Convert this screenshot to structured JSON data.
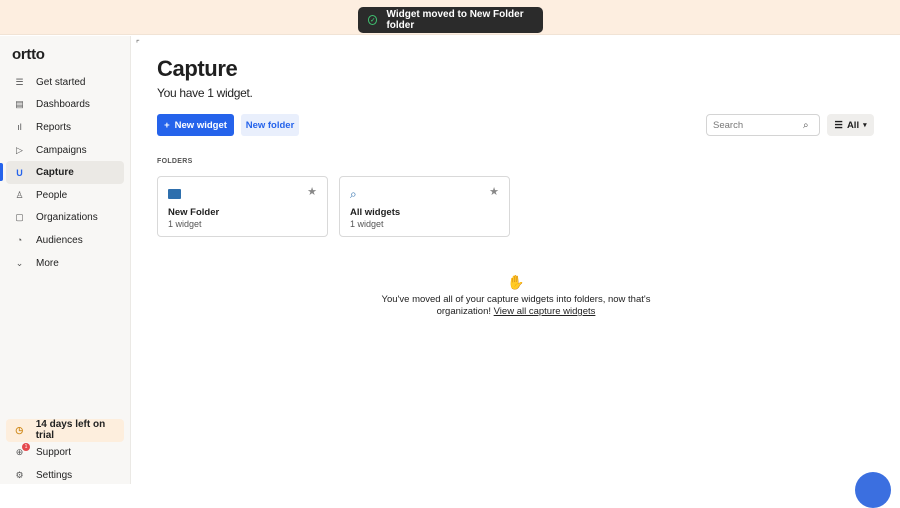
{
  "toast": {
    "message": "Widget moved to New Folder folder"
  },
  "sidebar": {
    "logo": "ortto",
    "items": [
      {
        "label": "Get started",
        "icon": "checklist-icon"
      },
      {
        "label": "Dashboards",
        "icon": "dashboard-icon"
      },
      {
        "label": "Reports",
        "icon": "bar-chart-icon"
      },
      {
        "label": "Campaigns",
        "icon": "send-icon"
      },
      {
        "label": "Capture",
        "icon": "magnet-icon",
        "active": true
      },
      {
        "label": "People",
        "icon": "person-icon"
      },
      {
        "label": "Organizations",
        "icon": "building-icon"
      },
      {
        "label": "Audiences",
        "icon": "pie-icon"
      },
      {
        "label": "More",
        "icon": "chevron-down-icon"
      }
    ],
    "bottom": [
      {
        "label": "14 days left on trial",
        "icon": "clock-icon"
      },
      {
        "label": "Support",
        "icon": "support-icon",
        "badge": "1"
      },
      {
        "label": "Settings",
        "icon": "gear-icon"
      }
    ]
  },
  "main": {
    "title": "Capture",
    "subtitle": "You have 1 widget.",
    "new_widget": "New widget",
    "new_folder": "New folder",
    "search_placeholder": "Search",
    "filter": "All",
    "folders_label": "FOLDERS",
    "folders": [
      {
        "name": "New Folder",
        "count": "1 widget"
      },
      {
        "name": "All widgets",
        "count": "1 widget"
      }
    ],
    "empty_text": "You've moved all of your capture widgets into folders, now that's organization!",
    "empty_link": "View all capture widgets"
  },
  "colors": {
    "accent": "#2563eb",
    "banner": "#fdeee0"
  }
}
